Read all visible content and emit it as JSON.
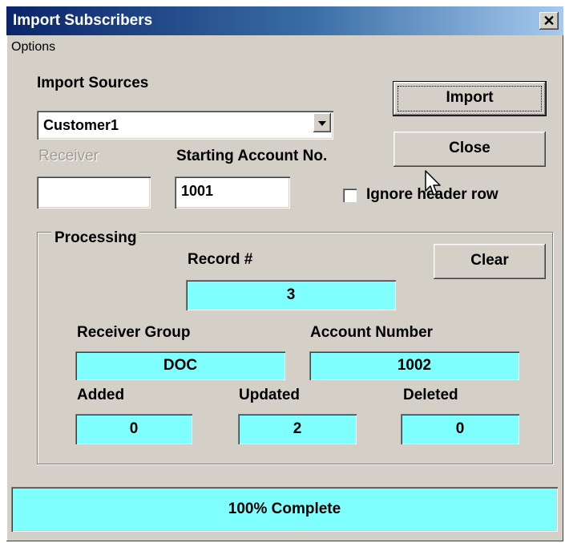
{
  "window": {
    "title": "Import Subscribers",
    "close_glyph": "✕"
  },
  "menu": {
    "items": [
      "Options"
    ]
  },
  "import_sources": {
    "label": "Import Sources",
    "selected": "Customer1"
  },
  "receiver": {
    "label": "Receiver",
    "value": ""
  },
  "starting_account": {
    "label": "Starting Account No.",
    "value": "1001"
  },
  "ignore_header": {
    "label": "Ignore header row",
    "checked": false
  },
  "buttons": {
    "import": "Import",
    "close": "Close",
    "clear": "Clear"
  },
  "processing": {
    "legend": "Processing",
    "record_label": "Record #",
    "record_value": "3",
    "receiver_group_label": "Receiver Group",
    "receiver_group_value": "DOC",
    "account_number_label": "Account Number",
    "account_number_value": "1002",
    "added_label": "Added",
    "added_value": "0",
    "updated_label": "Updated",
    "updated_value": "2",
    "deleted_label": "Deleted",
    "deleted_value": "0"
  },
  "progress": {
    "text": "100% Complete",
    "fraction": 1.0
  },
  "colors": {
    "field_cyan": "#80ffff",
    "title_bar": "#0a246a",
    "dialog_face": "#d4d0c8"
  },
  "icons": {
    "cursor": "mouse-pointer-icon",
    "dropdown": "chevron-down-icon",
    "close": "close-icon"
  }
}
